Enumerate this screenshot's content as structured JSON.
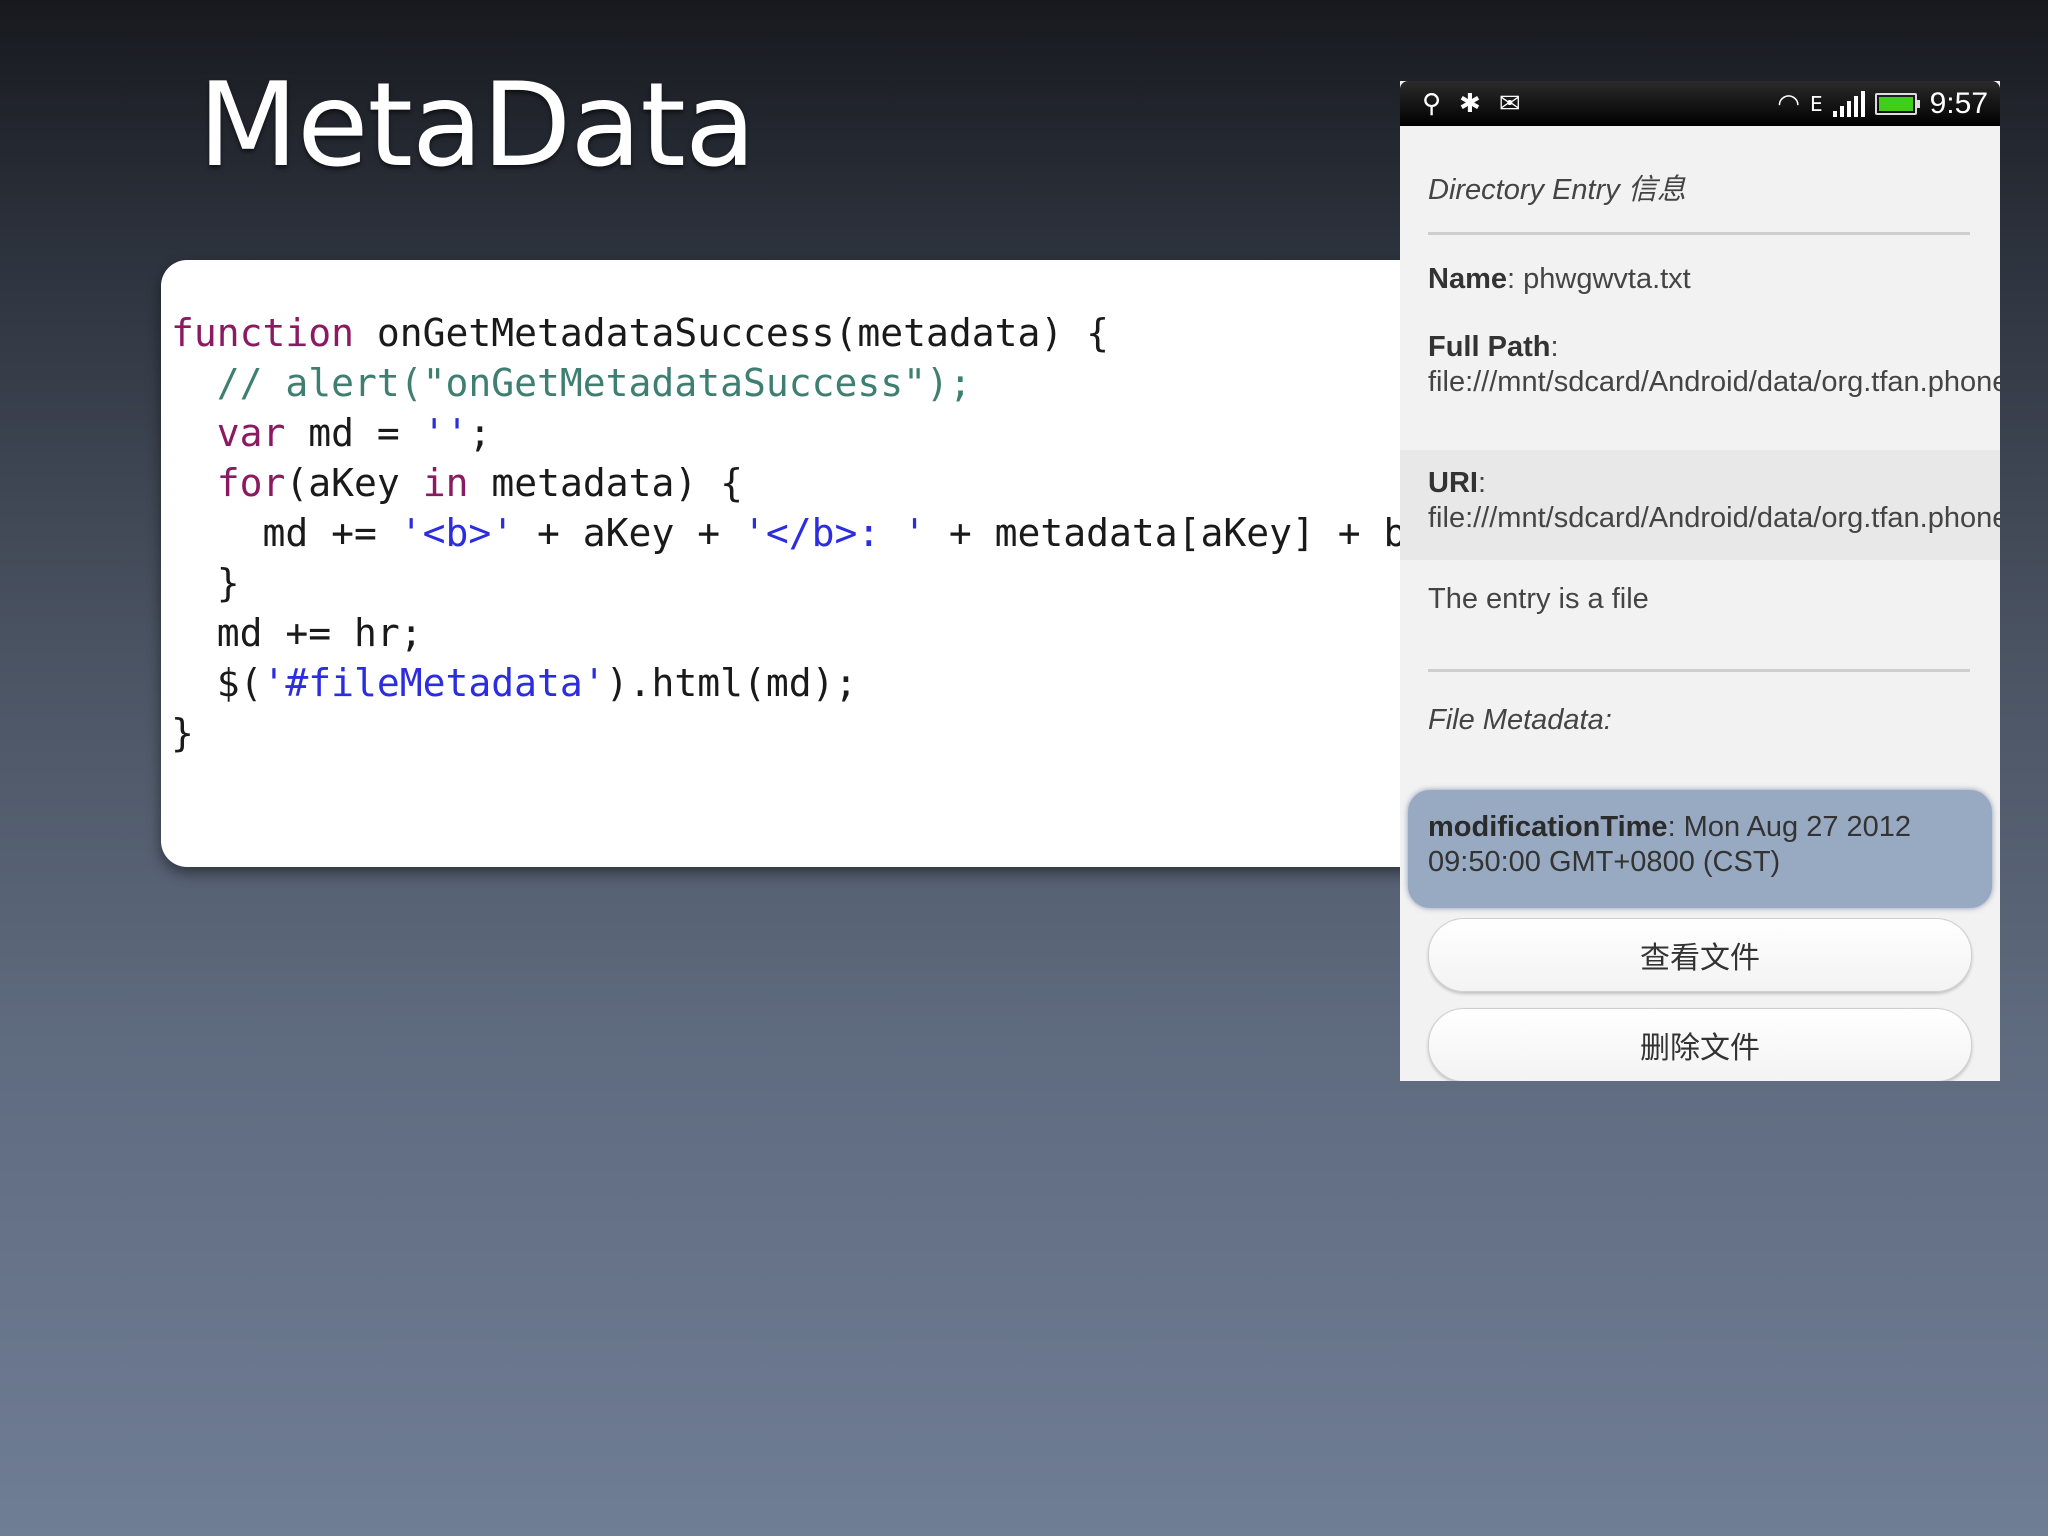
{
  "slide": {
    "title": "MetaData"
  },
  "code": {
    "lines": [
      [
        {
          "t": "function",
          "c": "kw"
        },
        {
          "t": " onGetMetadataSuccess(metadata) {",
          "c": ""
        }
      ],
      [
        {
          "t": "  // alert(\"onGetMetadataSuccess\");",
          "c": "cm"
        }
      ],
      [
        {
          "t": "  ",
          "c": ""
        },
        {
          "t": "var",
          "c": "kw"
        },
        {
          "t": " md = ",
          "c": ""
        },
        {
          "t": "''",
          "c": "st"
        },
        {
          "t": ";",
          "c": ""
        }
      ],
      [
        {
          "t": "  ",
          "c": ""
        },
        {
          "t": "for",
          "c": "kw"
        },
        {
          "t": "(aKey ",
          "c": ""
        },
        {
          "t": "in",
          "c": "kw"
        },
        {
          "t": " metadata) {",
          "c": ""
        }
      ],
      [
        {
          "t": "    md += ",
          "c": ""
        },
        {
          "t": "'<b>'",
          "c": "st"
        },
        {
          "t": " + aKey + ",
          "c": ""
        },
        {
          "t": "'</b>: '",
          "c": "st"
        },
        {
          "t": " + metadata[aKey] + br;",
          "c": ""
        }
      ],
      [
        {
          "t": "  }",
          "c": ""
        }
      ],
      [
        {
          "t": "  md += hr;",
          "c": ""
        }
      ],
      [
        {
          "t": "  $(",
          "c": ""
        },
        {
          "t": "'#fileMetadata'",
          "c": "st"
        },
        {
          "t": ").html(md);",
          "c": ""
        }
      ],
      [
        {
          "t": "}",
          "c": ""
        }
      ]
    ]
  },
  "phone": {
    "status_bar": {
      "left_icons": [
        "usb-icon",
        "android-debug-icon",
        "message-icon"
      ],
      "network_type": "E",
      "time": "9:57"
    },
    "directory_entry_heading": "Directory Entry 信息",
    "name_label": "Name",
    "name_value": ": phwgwvta.txt",
    "full_path_label": "Full Path",
    "full_path_value": ": file:///mnt/sdcard/Android/data/org.tfan.phonegap.file/cache/phwgwvta.txt",
    "uri_label": "URI",
    "uri_value": ": file:///mnt/sdcard/Android/data/org.tfan.phonegap.file/cache/phwgwvta.txt",
    "entry_type": "The entry is a file",
    "file_metadata_heading": "File Metadata:",
    "modification_label": "modificationTime",
    "modification_value": ": Mon Aug 27 2012 09:50:00 GMT+0800 (CST)",
    "view_file_button": "查看文件",
    "delete_file_button": "删除文件"
  }
}
